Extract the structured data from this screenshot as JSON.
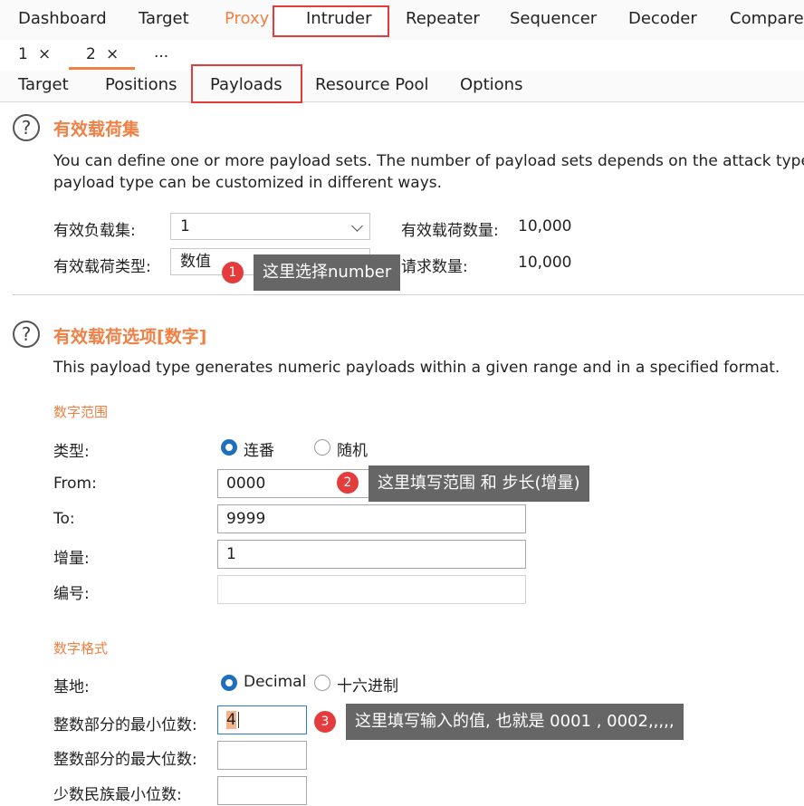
{
  "top_tabs": [
    "Dashboard",
    "Target",
    "Proxy",
    "Intruder",
    "Repeater",
    "Sequencer",
    "Decoder",
    "Comparer"
  ],
  "num_tabs": [
    {
      "label": "1",
      "close": "×"
    },
    {
      "label": "2",
      "close": "×"
    },
    {
      "label": "..."
    }
  ],
  "sub_tabs": [
    "Target",
    "Positions",
    "Payloads",
    "Resource Pool",
    "Options"
  ],
  "payload_sets": {
    "help": "?",
    "title": "有效载荷集",
    "desc1": "You can define one or more payload sets. The number of payload sets depends on the attack type de",
    "desc2": "payload type can be customized in different ways.",
    "set_label": "有效负载集:",
    "set_value": "1",
    "type_label": "有效载荷类型:",
    "type_value": "数值",
    "count_label": "有效载荷数量:",
    "count_value": "10,000",
    "requests_label": "请求数量:",
    "requests_value": "10,000"
  },
  "payload_options": {
    "help": "?",
    "title": "有效载荷选项[数字]",
    "desc": "This payload type generates numeric payloads within a given range and in a specified format.",
    "range_head": "数字范围",
    "type_label": "类型:",
    "type_opt1": "连番",
    "type_opt2": "随机",
    "from_label": "From:",
    "from_value": "0000",
    "to_label": "To:",
    "to_value": "9999",
    "step_label": "增量:",
    "step_value": "1",
    "howmany_label": "编号:",
    "howmany_value": "",
    "format_head": "数字格式",
    "base_label": "基地:",
    "base_opt1": "Decimal",
    "base_opt2": "十六进制",
    "min_int_label": "整数部分的最小位数:",
    "min_int_value": "4",
    "max_int_label": "整数部分的最大位数:",
    "max_int_value": "",
    "min_frac_label": "少数民族最小位数:",
    "min_frac_value": ""
  },
  "callouts": [
    {
      "num": "1",
      "text": "这里选择number"
    },
    {
      "num": "2",
      "text": "这里填写范围  和  步长(增量)"
    },
    {
      "num": "3",
      "text": "这里填写输入的值, 也就是 0001 , 0002,,,,,"
    }
  ],
  "colors": {
    "accent": "#f08044",
    "highlight_box": "#e63b3b",
    "callout_bg": "#666666",
    "badge": "#e43c3c",
    "radio": "#1f6fbf"
  }
}
